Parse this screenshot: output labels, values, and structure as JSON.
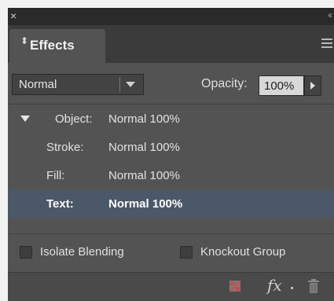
{
  "titlebar": {
    "close_glyph": "×",
    "collapse_glyph": "‹‹"
  },
  "panel": {
    "tab_title": "Effects",
    "tab_glyph": "⬍"
  },
  "blend": {
    "mode": "Normal"
  },
  "opacity": {
    "label": "Opacity:",
    "value": "100%"
  },
  "targets": [
    {
      "label": "Object:",
      "value": "Normal 100%",
      "selected": false,
      "expanded": true
    },
    {
      "label": "Stroke:",
      "value": "Normal 100%",
      "selected": false
    },
    {
      "label": "Fill:",
      "value": "Normal 100%",
      "selected": false
    },
    {
      "label": "Text:",
      "value": "Normal 100%",
      "selected": true
    }
  ],
  "options": {
    "isolate_blending": {
      "label": "Isolate Blending",
      "checked": false
    },
    "knockout_group": {
      "label": "Knockout Group",
      "checked": false
    }
  },
  "footer": {
    "fx_label": "fx"
  },
  "colors": {
    "panel_bg": "#535353",
    "selected_row": "#4a5868",
    "tab_bar": "#3b3b3b"
  },
  "icons": [
    "close-icon",
    "collapse-icon",
    "panel-menu-icon",
    "clear-effects-icon",
    "fx-icon",
    "trash-icon"
  ]
}
